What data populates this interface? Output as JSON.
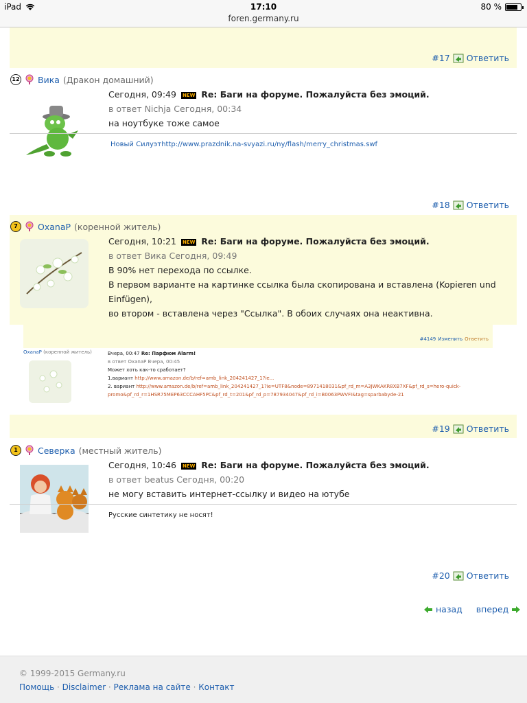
{
  "status_bar": {
    "device": "iPad",
    "time": "17:10",
    "url": "foren.germany.ru",
    "battery": "80 %",
    "battery_level": 0.8
  },
  "posts": [
    {
      "num": "#17",
      "reply": "Ответить"
    },
    {
      "author": "Вика",
      "status": "(Дракон домашний)",
      "rank": "12",
      "date": "Сегодня, 09:49",
      "new": "NEW",
      "subject": "Re: Баги на форуме. Пожалуйста без эмоций.",
      "in_reply": "в ответ Nichja Сегодня, 00:34",
      "text": [
        "на ноутбуке тоже самое"
      ],
      "signature": "Новый Силуэтhttp://www.prazdnik.na-svyazi.ru/ny/flash/merry_christmas.swf",
      "num": "#18",
      "reply": "Ответить"
    },
    {
      "author": "OxanaP",
      "status": "(коренной житель)",
      "rank": "7",
      "date": "Сегодня, 10:21",
      "new": "NEW",
      "subject": "Re: Баги на форуме. Пожалуйста без эмоций.",
      "in_reply": "в ответ Вика Сегодня, 09:49",
      "text": [
        "В 90% нет перехода по ссылке.",
        "В первом варианте на картинке ссылка была скопирована и вставлена (Kopieren und Einfügen),",
        "во втором - вставлена через \"Ссылка\". В обоих случаях она неактивна."
      ],
      "num": "#19",
      "reply": "Ответить",
      "embedded": {
        "num": "#4149",
        "edit": "Изменить",
        "reply": "Ответить",
        "author": "OxanaP",
        "status": "(коренной житель)",
        "date": "Вчера, 00:47",
        "subject": "Re: Парфюм Alarm!",
        "in_reply": "в ответ OxanaP Вчера, 00:45",
        "line1": "Может хоть как-то сработает?",
        "v1_label": "1.вариант",
        "v1_link": "http://www.amazon.de/b/ref=amb_link_204241427_1?ie...",
        "v2_label": "2. вариант",
        "v2_link": "http://www.amazon.de/b/ref=amb_link_204241427_1?ie=UTF8&node=8971418031&pf_rd_m=A3JWKAKR8XB7XF&pf_rd_s=hero-quick-",
        "v2_link_cont": "promo&pf_rd_r=1HSR75MEP63CCCAHF5PC&pf_rd_t=201&pf_rd_p=787934047&pf_rd_i=B0063PWVFI&tag=sparbabyde-21"
      }
    },
    {
      "author": "Северка",
      "status": "(местный житель)",
      "rank": "1",
      "date": "Сегодня, 10:46",
      "new": "NEW",
      "subject": "Re: Баги на форуме. Пожалуйста без эмоций.",
      "in_reply": "в ответ beatus Сегодня, 00:20",
      "text": [
        "не могу вставить интернет-ссылку и видео на ютубе"
      ],
      "signature": "Русские синтетику не носят!",
      "num": "#20",
      "reply": "Ответить"
    }
  ],
  "pager": {
    "prev": "назад",
    "next": "вперед"
  },
  "footer": {
    "copyright": "© 1999-2015 Germany.ru",
    "links": [
      "Помощь",
      "Disclaimer",
      "Реклама на сайте",
      "Контакт"
    ]
  }
}
